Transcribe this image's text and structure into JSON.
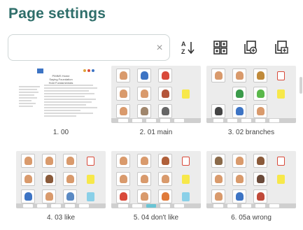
{
  "header": {
    "title": "Page settings"
  },
  "search": {
    "value": "",
    "placeholder": "",
    "clear_glyph": "×"
  },
  "toolbar": [
    {
      "name": "sort-az-icon"
    },
    {
      "name": "grid-view-icon"
    },
    {
      "name": "add-page-icon"
    },
    {
      "name": "add-page-alt-icon"
    }
  ],
  "doc_preview": {
    "heading": [
      "PIMMS Home",
      "Saying Foundation",
      "Hold Fundamentals"
    ]
  },
  "pages": [
    {
      "label": "1. 00",
      "kind": "doc"
    },
    {
      "label": "2. 01 main",
      "kind": "board"
    },
    {
      "label": "3. 02 branches",
      "kind": "board"
    },
    {
      "label": "4. 03 like",
      "kind": "board"
    },
    {
      "label": "5. 04 don't like",
      "kind": "board"
    },
    {
      "label": "6. 05a wrong",
      "kind": "board"
    }
  ],
  "colors": {
    "accent": "#2e6e6a",
    "symbol_yellow": "#f7e84a",
    "symbol_red": "#d94a3a",
    "symbol_blue": "#3d74c4",
    "symbol_skin": "#d99a6c"
  }
}
